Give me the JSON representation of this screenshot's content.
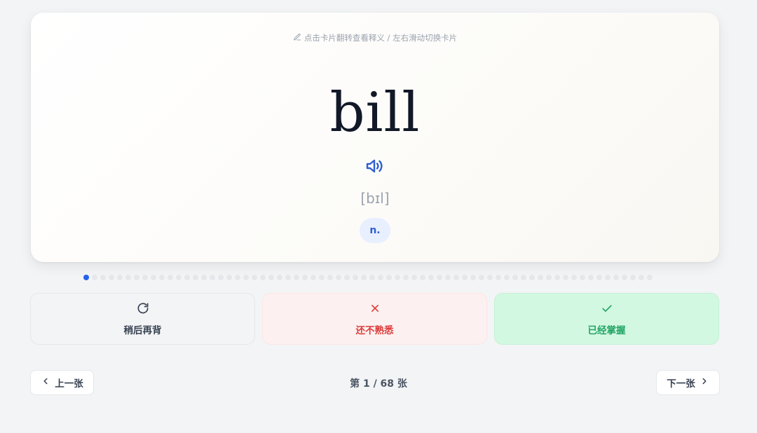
{
  "card": {
    "hint": "点击卡片翻转查看释义 / 左右滑动切换卡片",
    "word": "bill",
    "phonetic": "[bɪl]",
    "part_of_speech": "n."
  },
  "progress": {
    "current": 1,
    "total": 68
  },
  "actions": {
    "later_label": "稍后再背",
    "unfamiliar_label": "还不熟悉",
    "mastered_label": "已经掌握"
  },
  "nav": {
    "prev_label": "上一张",
    "next_label": "下一张",
    "counter": "第 1 / 68 张"
  },
  "icons": {
    "hint": "pencil-icon",
    "speaker": "speaker-icon",
    "later": "refresh-icon",
    "unfamiliar": "close-icon",
    "mastered": "check-icon",
    "prev": "chevron-left-icon",
    "next": "chevron-right-icon"
  },
  "colors": {
    "accent": "#2563eb",
    "danger": "#dc3c3c",
    "success": "#1fa463"
  }
}
